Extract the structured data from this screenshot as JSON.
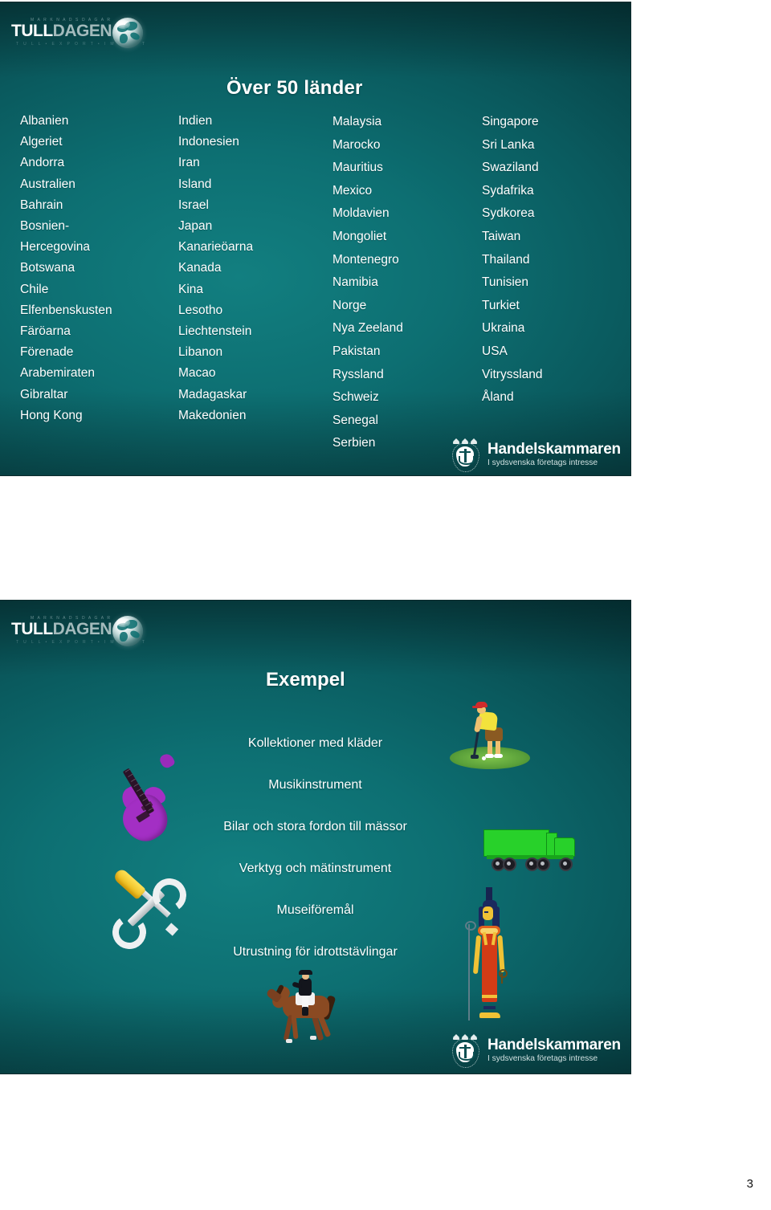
{
  "document": {
    "page_number": "3",
    "slides": [
      {
        "id": "slide-countries",
        "title": "Över 50 länder",
        "brand_logo": {
          "word_part_1": "TULL",
          "word_part_2": "DAGEN",
          "top_micro_text": "M A R K N A D S D A G A R",
          "bottom_micro_text": "T U L L   •   E X P O R T   •   I M P O R T",
          "globe_icon": "globe-icon"
        },
        "footer_logo": {
          "name": "Handelskammaren",
          "tagline": "I sydsvenska företags intresse",
          "crest_icon": "crest-shield-anchor-icon"
        },
        "columns": [
          {
            "id": "column-1",
            "items": [
              "Albanien",
              "Algeriet",
              "Andorra",
              "Australien",
              "Bahrain",
              "Bosnien-",
              "Hercegovina",
              "Botswana",
              "Chile",
              "Elfenbenskusten",
              "Färöarna",
              "Förenade",
              "Arabemiraten",
              "Gibraltar",
              "Hong Kong"
            ]
          },
          {
            "id": "column-2",
            "items": [
              "Indien",
              "Indonesien",
              "Iran",
              "Island",
              "Israel",
              "Japan",
              "Kanarieöarna",
              "Kanada",
              "Kina",
              "Lesotho",
              "Liechtenstein",
              "Libanon",
              "Macao",
              "Madagaskar",
              "Makedonien"
            ]
          },
          {
            "id": "column-3",
            "items": [
              "Malaysia",
              "Marocko",
              "Mauritius",
              "Mexico",
              "Moldavien",
              "Mongoliet",
              "Montenegro",
              "Namibia",
              "Norge",
              "Nya Zeeland",
              "Pakistan",
              "Ryssland",
              "Schweiz",
              "Senegal",
              "Serbien"
            ]
          },
          {
            "id": "column-4",
            "items": [
              "Singapore",
              "Sri Lanka",
              "Swaziland",
              "Sydafrika",
              "Sydkorea",
              "Taiwan",
              "Thailand",
              "Tunisien",
              "Turkiet",
              "Ukraina",
              "USA",
              "Vitryssland",
              "Åland"
            ]
          }
        ]
      },
      {
        "id": "slide-examples",
        "title": "Exempel",
        "brand_logo": {
          "word_part_1": "TULL",
          "word_part_2": "DAGEN",
          "top_micro_text": "M A R K N A D S D A G A R",
          "bottom_micro_text": "T U L L   •   E X P O R T   •   I M P O R T",
          "globe_icon": "globe-icon"
        },
        "footer_logo": {
          "name": "Handelskammaren",
          "tagline": "I sydsvenska företags intresse",
          "crest_icon": "crest-shield-anchor-icon"
        },
        "items": [
          "Kollektioner med kläder",
          "Musikinstrument",
          "Bilar och stora fordon till mässor",
          "Verktyg och mätinstrument",
          "Museiföremål",
          "Utrustning för idrottstävlingar"
        ],
        "illustrations": [
          {
            "name": "electric-guitar-illustration",
            "color": "#a32fc4"
          },
          {
            "name": "golfer-illustration",
            "color": "#5aa03a"
          },
          {
            "name": "green-semi-truck-illustration",
            "color": "#28d12a"
          },
          {
            "name": "tools-screwdriver-wrench-illustration",
            "color": "#e8b20c"
          },
          {
            "name": "egyptian-figure-illustration",
            "color": "#d33c16"
          },
          {
            "name": "dressage-horse-rider-illustration",
            "color": "#8a4a22"
          }
        ]
      }
    ],
    "colors": {
      "slide_background_teal": "#0d6f72",
      "slide_background_dark": "#032e32",
      "text_white": "#ffffff",
      "page_number_black": "#111111"
    }
  }
}
